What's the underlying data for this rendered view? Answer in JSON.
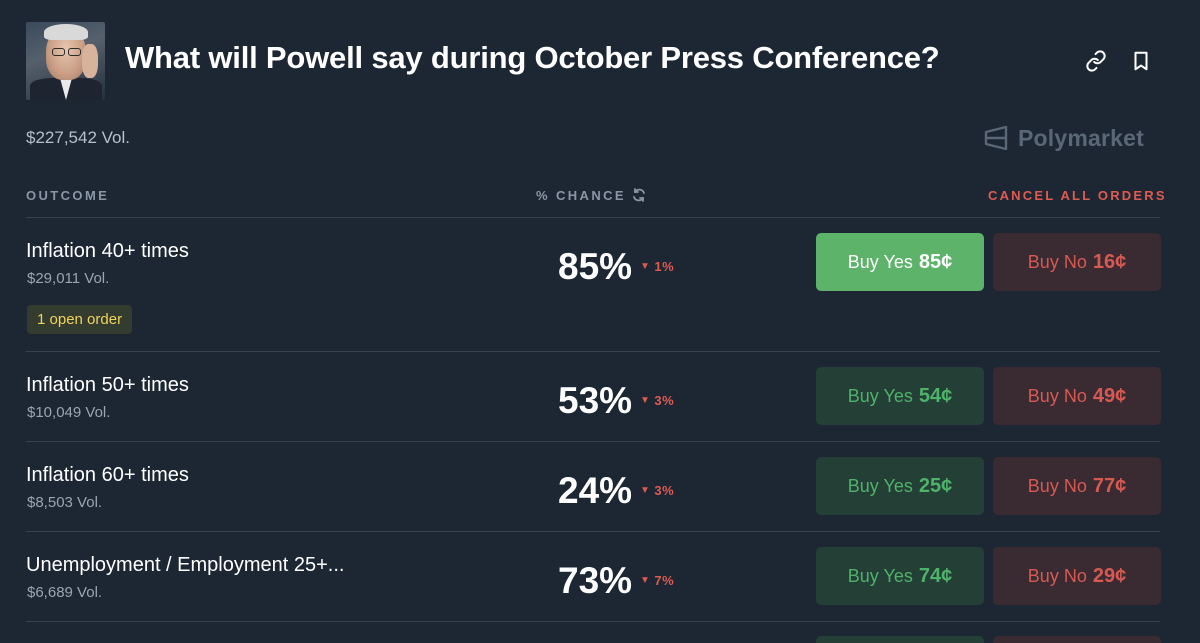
{
  "header": {
    "title": "What will Powell say during October Press Conference?",
    "volume": "$227,542 Vol.",
    "brand": "Polymarket"
  },
  "columns": {
    "outcome": "OUTCOME",
    "chance": "% CHANCE",
    "cancel_all": "CANCEL ALL ORDERS"
  },
  "outcomes": [
    {
      "name": "Inflation 40+ times",
      "volume": "$29,011 Vol.",
      "chance": "85%",
      "delta": "1%",
      "yes_label": "Buy Yes",
      "yes_price": "85¢",
      "no_label": "Buy No",
      "no_price": "16¢",
      "open_order": "1 open order"
    },
    {
      "name": "Inflation 50+ times",
      "volume": "$10,049 Vol.",
      "chance": "53%",
      "delta": "3%",
      "yes_label": "Buy Yes",
      "yes_price": "54¢",
      "no_label": "Buy No",
      "no_price": "49¢"
    },
    {
      "name": "Inflation 60+ times",
      "volume": "$8,503 Vol.",
      "chance": "24%",
      "delta": "3%",
      "yes_label": "Buy Yes",
      "yes_price": "25¢",
      "no_label": "Buy No",
      "no_price": "77¢"
    },
    {
      "name": "Unemployment / Employment 25+...",
      "volume": "$6,689 Vol.",
      "chance": "73%",
      "delta": "7%",
      "yes_label": "Buy Yes",
      "yes_price": "74¢",
      "no_label": "Buy No",
      "no_price": "29¢"
    }
  ],
  "colors": {
    "background": "#1d2734",
    "yes_active": "#5db36a",
    "yes_idle": "#244036",
    "no_idle": "#3a2a32",
    "down": "#e05a50",
    "order_badge": "#f0d25c"
  },
  "icons": [
    "link-icon",
    "bookmark-icon",
    "polymarket-logo-icon",
    "refresh-icon",
    "down-triangle-icon"
  ]
}
